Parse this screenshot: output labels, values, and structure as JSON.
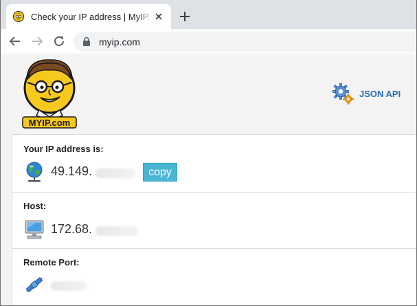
{
  "browser": {
    "tab_title": "Check your IP address | MyIP.com",
    "url": "myip.com"
  },
  "header": {
    "logo_text": "MYIP.com",
    "json_api_label": "JSON API"
  },
  "sections": {
    "ip": {
      "label": "Your IP address is:",
      "value": "49.149.",
      "copy_label": "copy"
    },
    "host": {
      "label": "Host:",
      "value": "172.68."
    },
    "port": {
      "label": "Remote Port:",
      "value": ""
    }
  },
  "colors": {
    "accent": "#2b6cb7",
    "copy_button": "#49b6d6",
    "tab_strip": "#dee1e6",
    "page_bg": "#f4f4f4"
  }
}
